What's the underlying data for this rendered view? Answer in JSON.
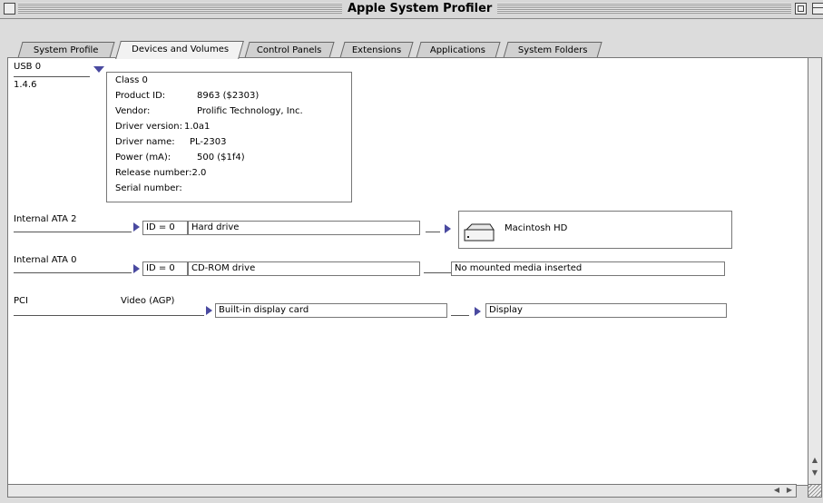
{
  "window": {
    "title": "Apple System Profiler"
  },
  "tabs": [
    {
      "label": "System Profile"
    },
    {
      "label": "Devices and Volumes"
    },
    {
      "label": "Control Panels"
    },
    {
      "label": "Extensions"
    },
    {
      "label": "Applications"
    },
    {
      "label": "System Folders"
    }
  ],
  "usb": {
    "bus": "USB 0",
    "version": "1.4.6",
    "details": [
      {
        "key": "Class 0",
        "value": ""
      },
      {
        "key": "Product ID:",
        "value": "8963 ($2303)"
      },
      {
        "key": "Vendor:",
        "value": "Prolific Technology, Inc."
      },
      {
        "key": "Driver version:",
        "value": "1.0a1"
      },
      {
        "key": "Driver name:",
        "value": "PL-2303"
      },
      {
        "key": "Power (mA):",
        "value": "500 ($1f4)"
      },
      {
        "key": "Release number:",
        "value": "2.0"
      },
      {
        "key": "Serial number:",
        "value": ""
      }
    ]
  },
  "ata2": {
    "bus": "Internal ATA 2",
    "id": "ID = 0",
    "device": "Hard drive",
    "volume": "Macintosh HD"
  },
  "ata0": {
    "bus": "Internal ATA 0",
    "id": "ID = 0",
    "device": "CD-ROM drive",
    "status": "No mounted media inserted"
  },
  "pci": {
    "bus": "PCI",
    "slot": "Video (AGP)",
    "device": "Built-in display card",
    "output": "Display"
  }
}
